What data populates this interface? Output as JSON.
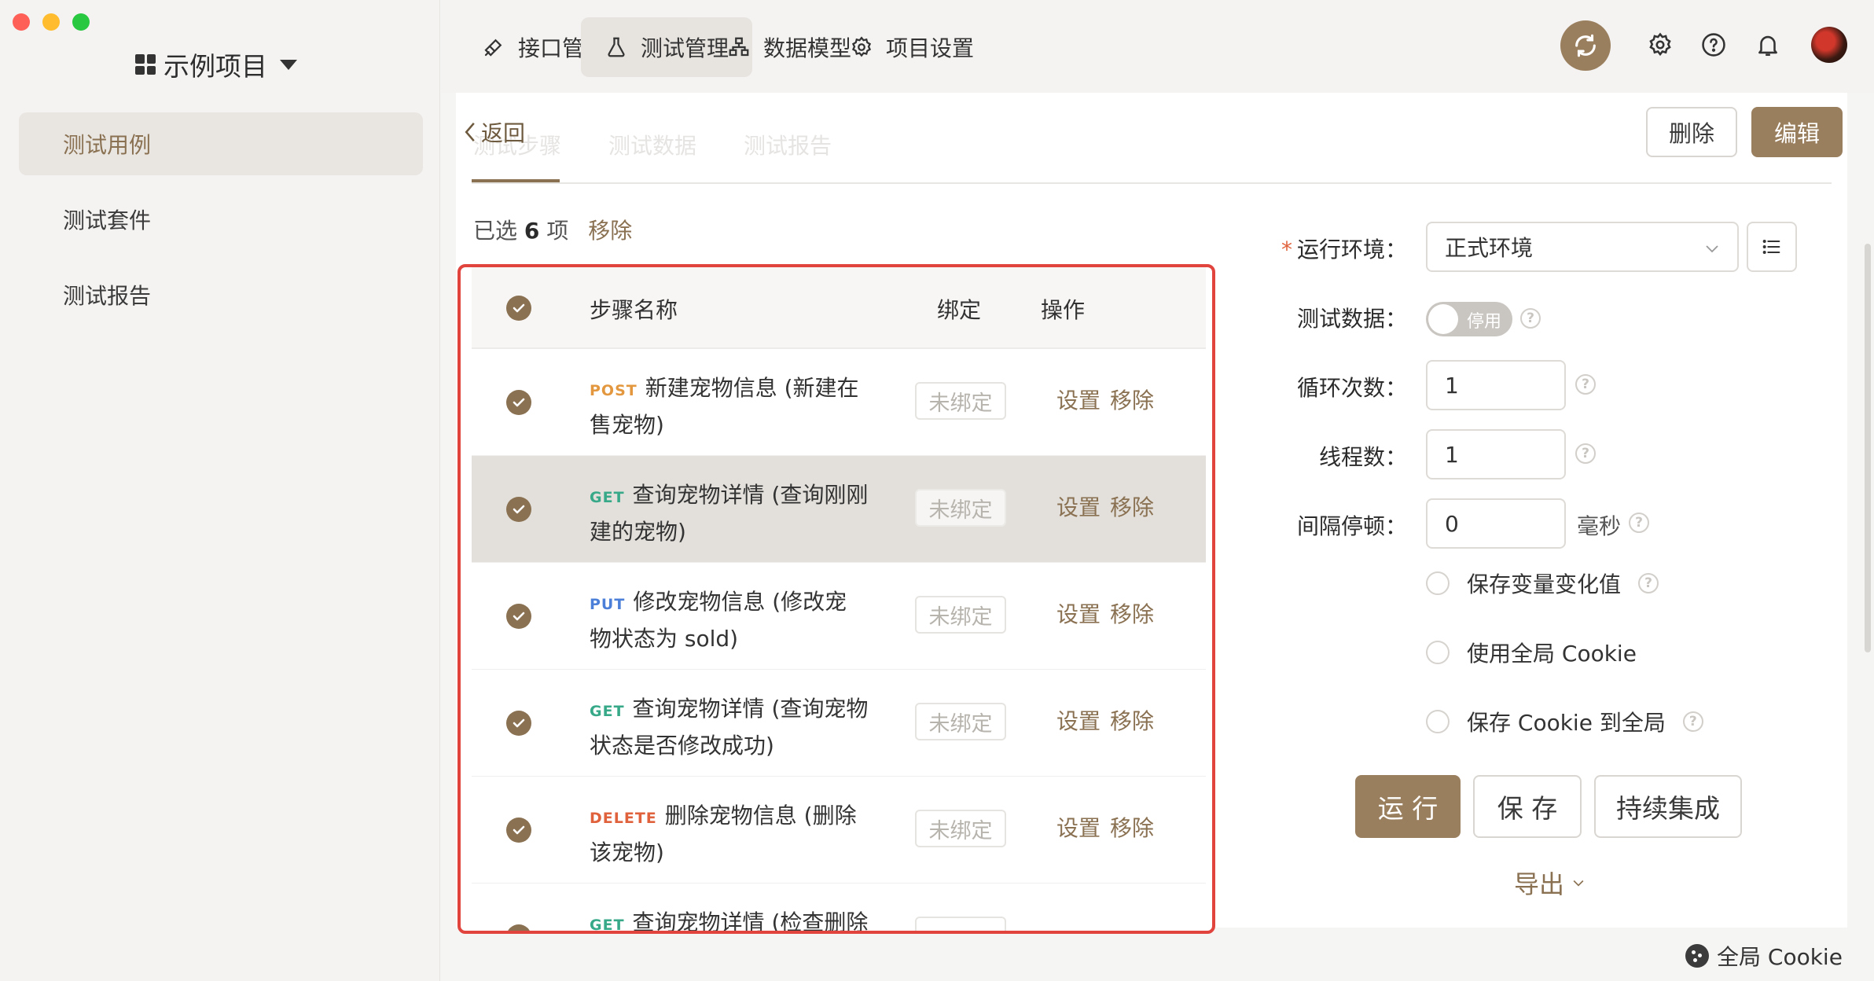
{
  "sidebar": {
    "project": "示例项目",
    "items": [
      {
        "label": "测试用例"
      },
      {
        "label": "测试套件"
      },
      {
        "label": "测试报告"
      }
    ]
  },
  "topnav": {
    "tabs": [
      {
        "label": "接口管理",
        "icon": "api-icon"
      },
      {
        "label": "测试管理",
        "icon": "flask-icon"
      },
      {
        "label": "数据模型",
        "icon": "sitemap-icon"
      },
      {
        "label": "项目设置",
        "icon": "gear-icon"
      }
    ],
    "active_tab": "测试管理"
  },
  "main": {
    "back": "返回",
    "ghost_tabs": [
      "测试步骤",
      "测试数据",
      "测试报告"
    ],
    "delete_btn": "删除",
    "edit_btn": "编辑",
    "selected_prefix": "已选",
    "selected_count": "6",
    "selected_suffix": "项",
    "remove_link": "移除"
  },
  "table": {
    "headers": {
      "name": "步骤名称",
      "bind": "绑定",
      "ops": "操作"
    },
    "rows": [
      {
        "method": "POST",
        "name": "新建宠物信息 (新建在",
        "name2": "售宠物)",
        "bind": "未绑定",
        "op1": "设置",
        "op2": "移除"
      },
      {
        "method": "GET",
        "name": "查询宠物详情 (查询刚刚",
        "name2": "建的宠物)",
        "bind": "未绑定",
        "op1": "设置",
        "op2": "移除"
      },
      {
        "method": "PUT",
        "name": "修改宠物信息 (修改宠",
        "name2": "物状态为 sold)",
        "bind": "未绑定",
        "op1": "设置",
        "op2": "移除"
      },
      {
        "method": "GET",
        "name": "查询宠物详情 (查询宠物",
        "name2": "状态是否修改成功)",
        "bind": "未绑定",
        "op1": "设置",
        "op2": "移除"
      },
      {
        "method": "DELETE",
        "name": "删除宠物信息 (删除",
        "name2": "该宠物)",
        "bind": "未绑定",
        "op1": "设置",
        "op2": "移除"
      },
      {
        "method": "GET",
        "name": "查询宠物详情 (检查删除",
        "name2": "",
        "bind": "",
        "op1": "",
        "op2": ""
      }
    ]
  },
  "form": {
    "env_label": "运行环境：",
    "env_value": "正式环境",
    "testdata_label": "测试数据：",
    "testdata_toggle": "停用",
    "loop_label": "循环次数：",
    "loop_value": "1",
    "threads_label": "线程数：",
    "threads_value": "1",
    "interval_label": "间隔停顿：",
    "interval_value": "0",
    "interval_unit": "毫秒",
    "cb1": "保存变量变化值",
    "cb2": "使用全局 Cookie",
    "cb3": "保存 Cookie 到全局",
    "run_btn": "运 行",
    "save_btn": "保 存",
    "ci_btn": "持续集成",
    "export": "导出"
  },
  "footer": {
    "global_cookie": "全局 Cookie"
  },
  "colors": {
    "accent": "#9a7f5e",
    "highlight_border": "#e0443c"
  }
}
